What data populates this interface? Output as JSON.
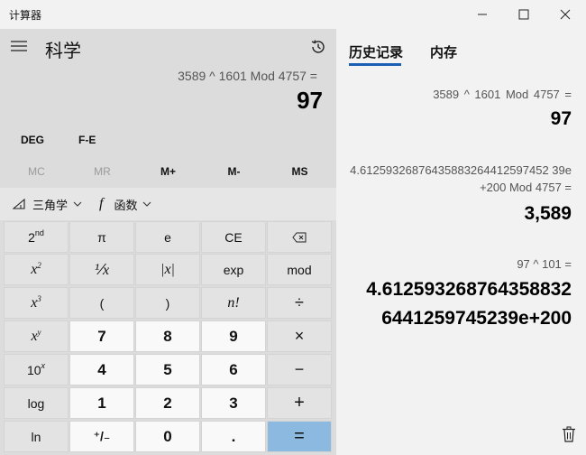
{
  "window": {
    "title": "计算器"
  },
  "calculator": {
    "mode": "科学",
    "expression": "3589 ^ 1601 Mod 4757 =",
    "result": "97",
    "angle_mode": "DEG",
    "notation": "F-E",
    "memory": [
      "MC",
      "MR",
      "M+",
      "M-",
      "MS"
    ],
    "functions": {
      "trig_label": "三角学",
      "func_label": "函数"
    },
    "keys": {
      "row1": [
        "2",
        "π",
        "e",
        "CE",
        "⌫"
      ],
      "row2": [
        "x",
        "⅟x",
        "|x|",
        "exp",
        "mod"
      ],
      "row3": [
        "x",
        "(",
        ")",
        "n!",
        "÷"
      ],
      "row4": [
        "x",
        "7",
        "8",
        "9",
        "×"
      ],
      "row5": [
        "10",
        "4",
        "5",
        "6",
        "−"
      ],
      "row6": [
        "log",
        "1",
        "2",
        "3",
        "+"
      ],
      "row7": [
        "ln",
        "⁺/₋",
        "0",
        ".",
        "="
      ],
      "sup": {
        "nd": "nd",
        "two": "2",
        "three": "3",
        "y": "y",
        "x": "x"
      }
    }
  },
  "history": {
    "tabs": [
      "历史记录",
      "内存"
    ],
    "entries": [
      {
        "expression": "3589   ^   1601   Mod   4757 =",
        "result": "97"
      },
      {
        "expression_line1": "4.61259326876435883264412597452 39e",
        "expression_line2": "+200   Mod   4757 =",
        "result": "3,589"
      },
      {
        "expression": "97   ^   101 =",
        "result_line1": "4.612593268764358832",
        "result_line2": "6441259745239e+200"
      }
    ]
  }
}
